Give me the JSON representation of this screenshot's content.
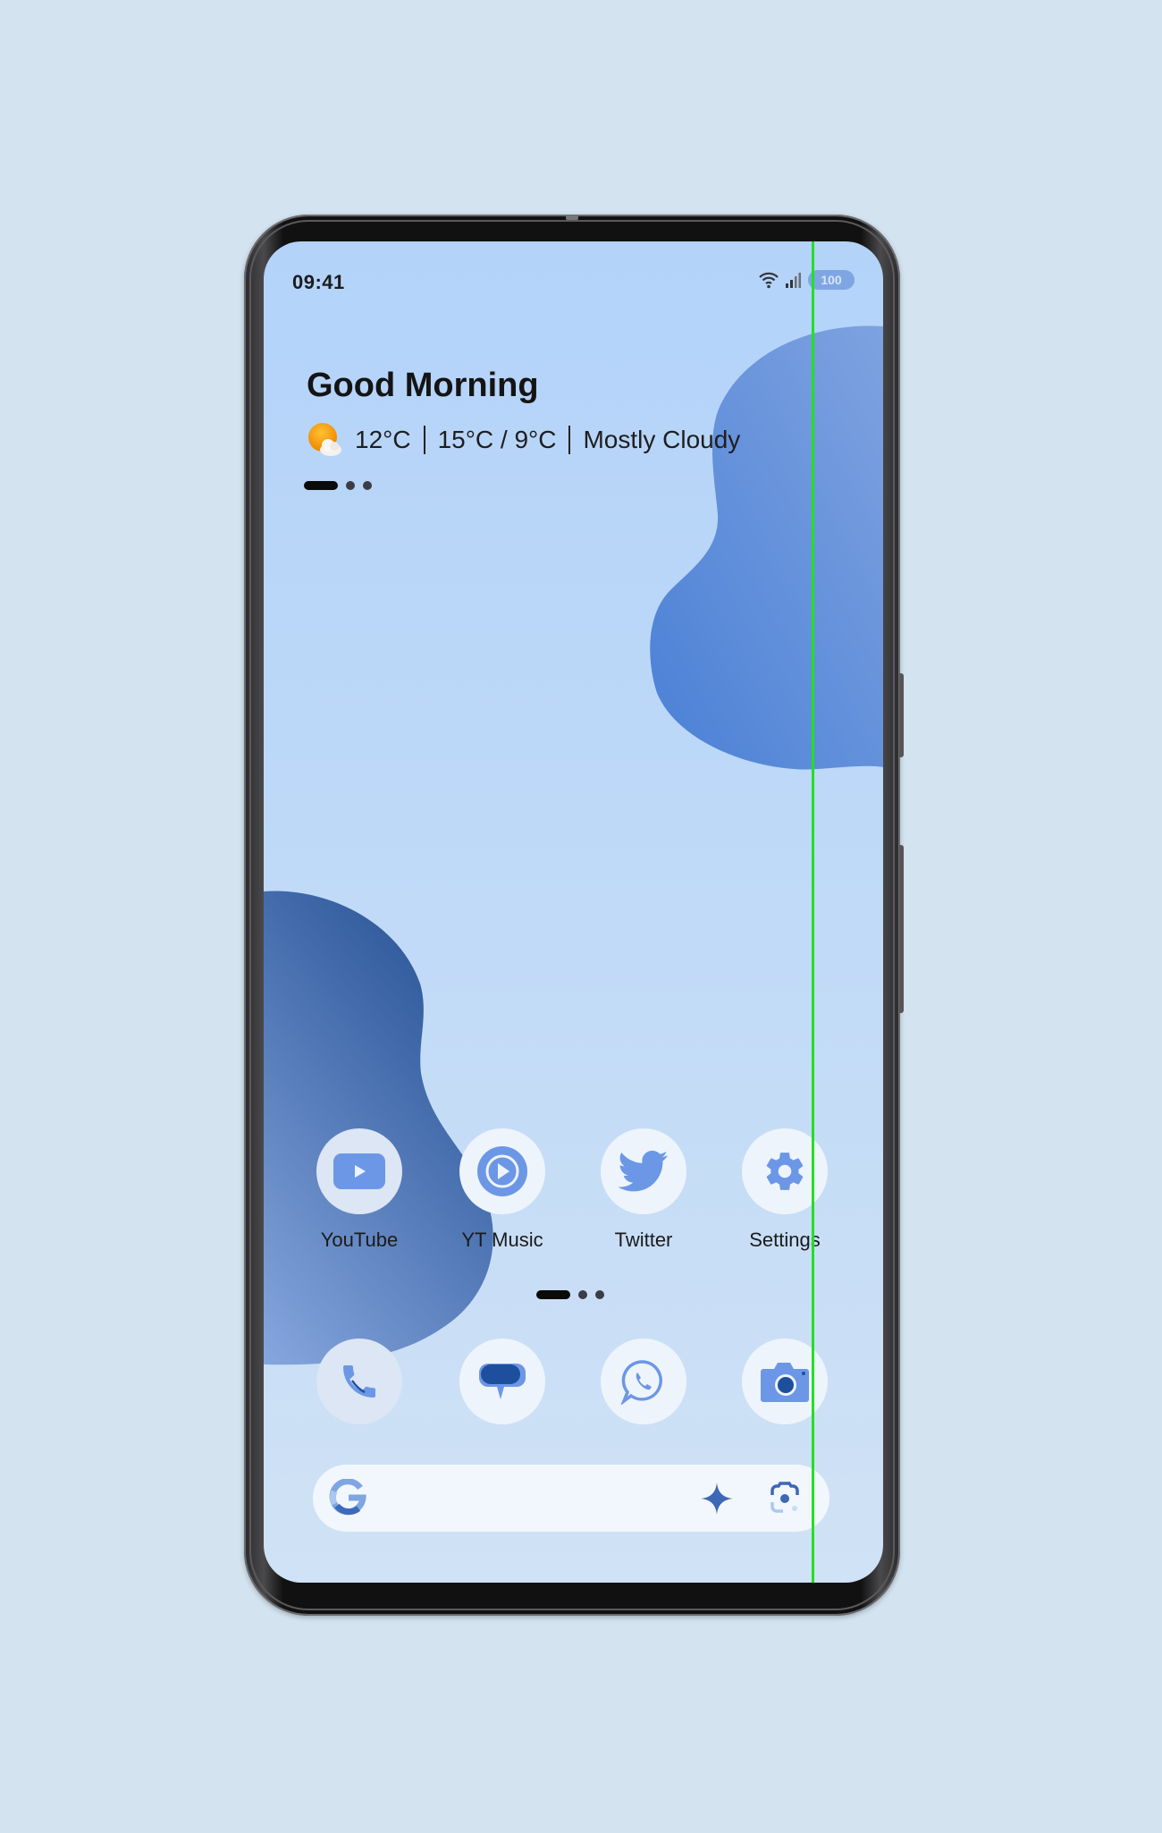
{
  "status_bar": {
    "time": "09:41",
    "wifi_icon": "wifi-icon",
    "signal_icon": "signal-icon",
    "battery_level": "100"
  },
  "widget": {
    "greeting": "Good Morning",
    "weather_icon": "partly-cloudy-icon",
    "current_temp": "12°C",
    "high_low": "15°C / 9°C",
    "condition": "Mostly Cloudy",
    "page_indicator": {
      "pages": 3,
      "active": 1
    }
  },
  "apps": [
    {
      "label": "YouTube",
      "icon": "youtube-icon"
    },
    {
      "label": "YT Music",
      "icon": "yt-music-icon"
    },
    {
      "label": "Twitter",
      "icon": "twitter-icon"
    },
    {
      "label": "Settings",
      "icon": "settings-gear-icon"
    }
  ],
  "home_page_indicator": {
    "pages": 3,
    "active": 1
  },
  "dock": [
    {
      "name": "Phone",
      "icon": "phone-icon"
    },
    {
      "name": "Messages",
      "icon": "messages-icon"
    },
    {
      "name": "WhatsApp",
      "icon": "whatsapp-icon"
    },
    {
      "name": "Camera",
      "icon": "camera-icon"
    }
  ],
  "search_bar": {
    "logo": "google-g-icon",
    "assistant_icon": "sparkle-icon",
    "lens_icon": "lens-icon"
  },
  "colors": {
    "background": "#D3E3F0",
    "wallpaper_top": "#B3D3F9",
    "blob_light": "#7A9FDF",
    "blob_dark": "#2D5A9E",
    "icon_accent": "#6B97E6",
    "icon_dark": "#1E4E9E",
    "overlay_line": "#22E022"
  }
}
